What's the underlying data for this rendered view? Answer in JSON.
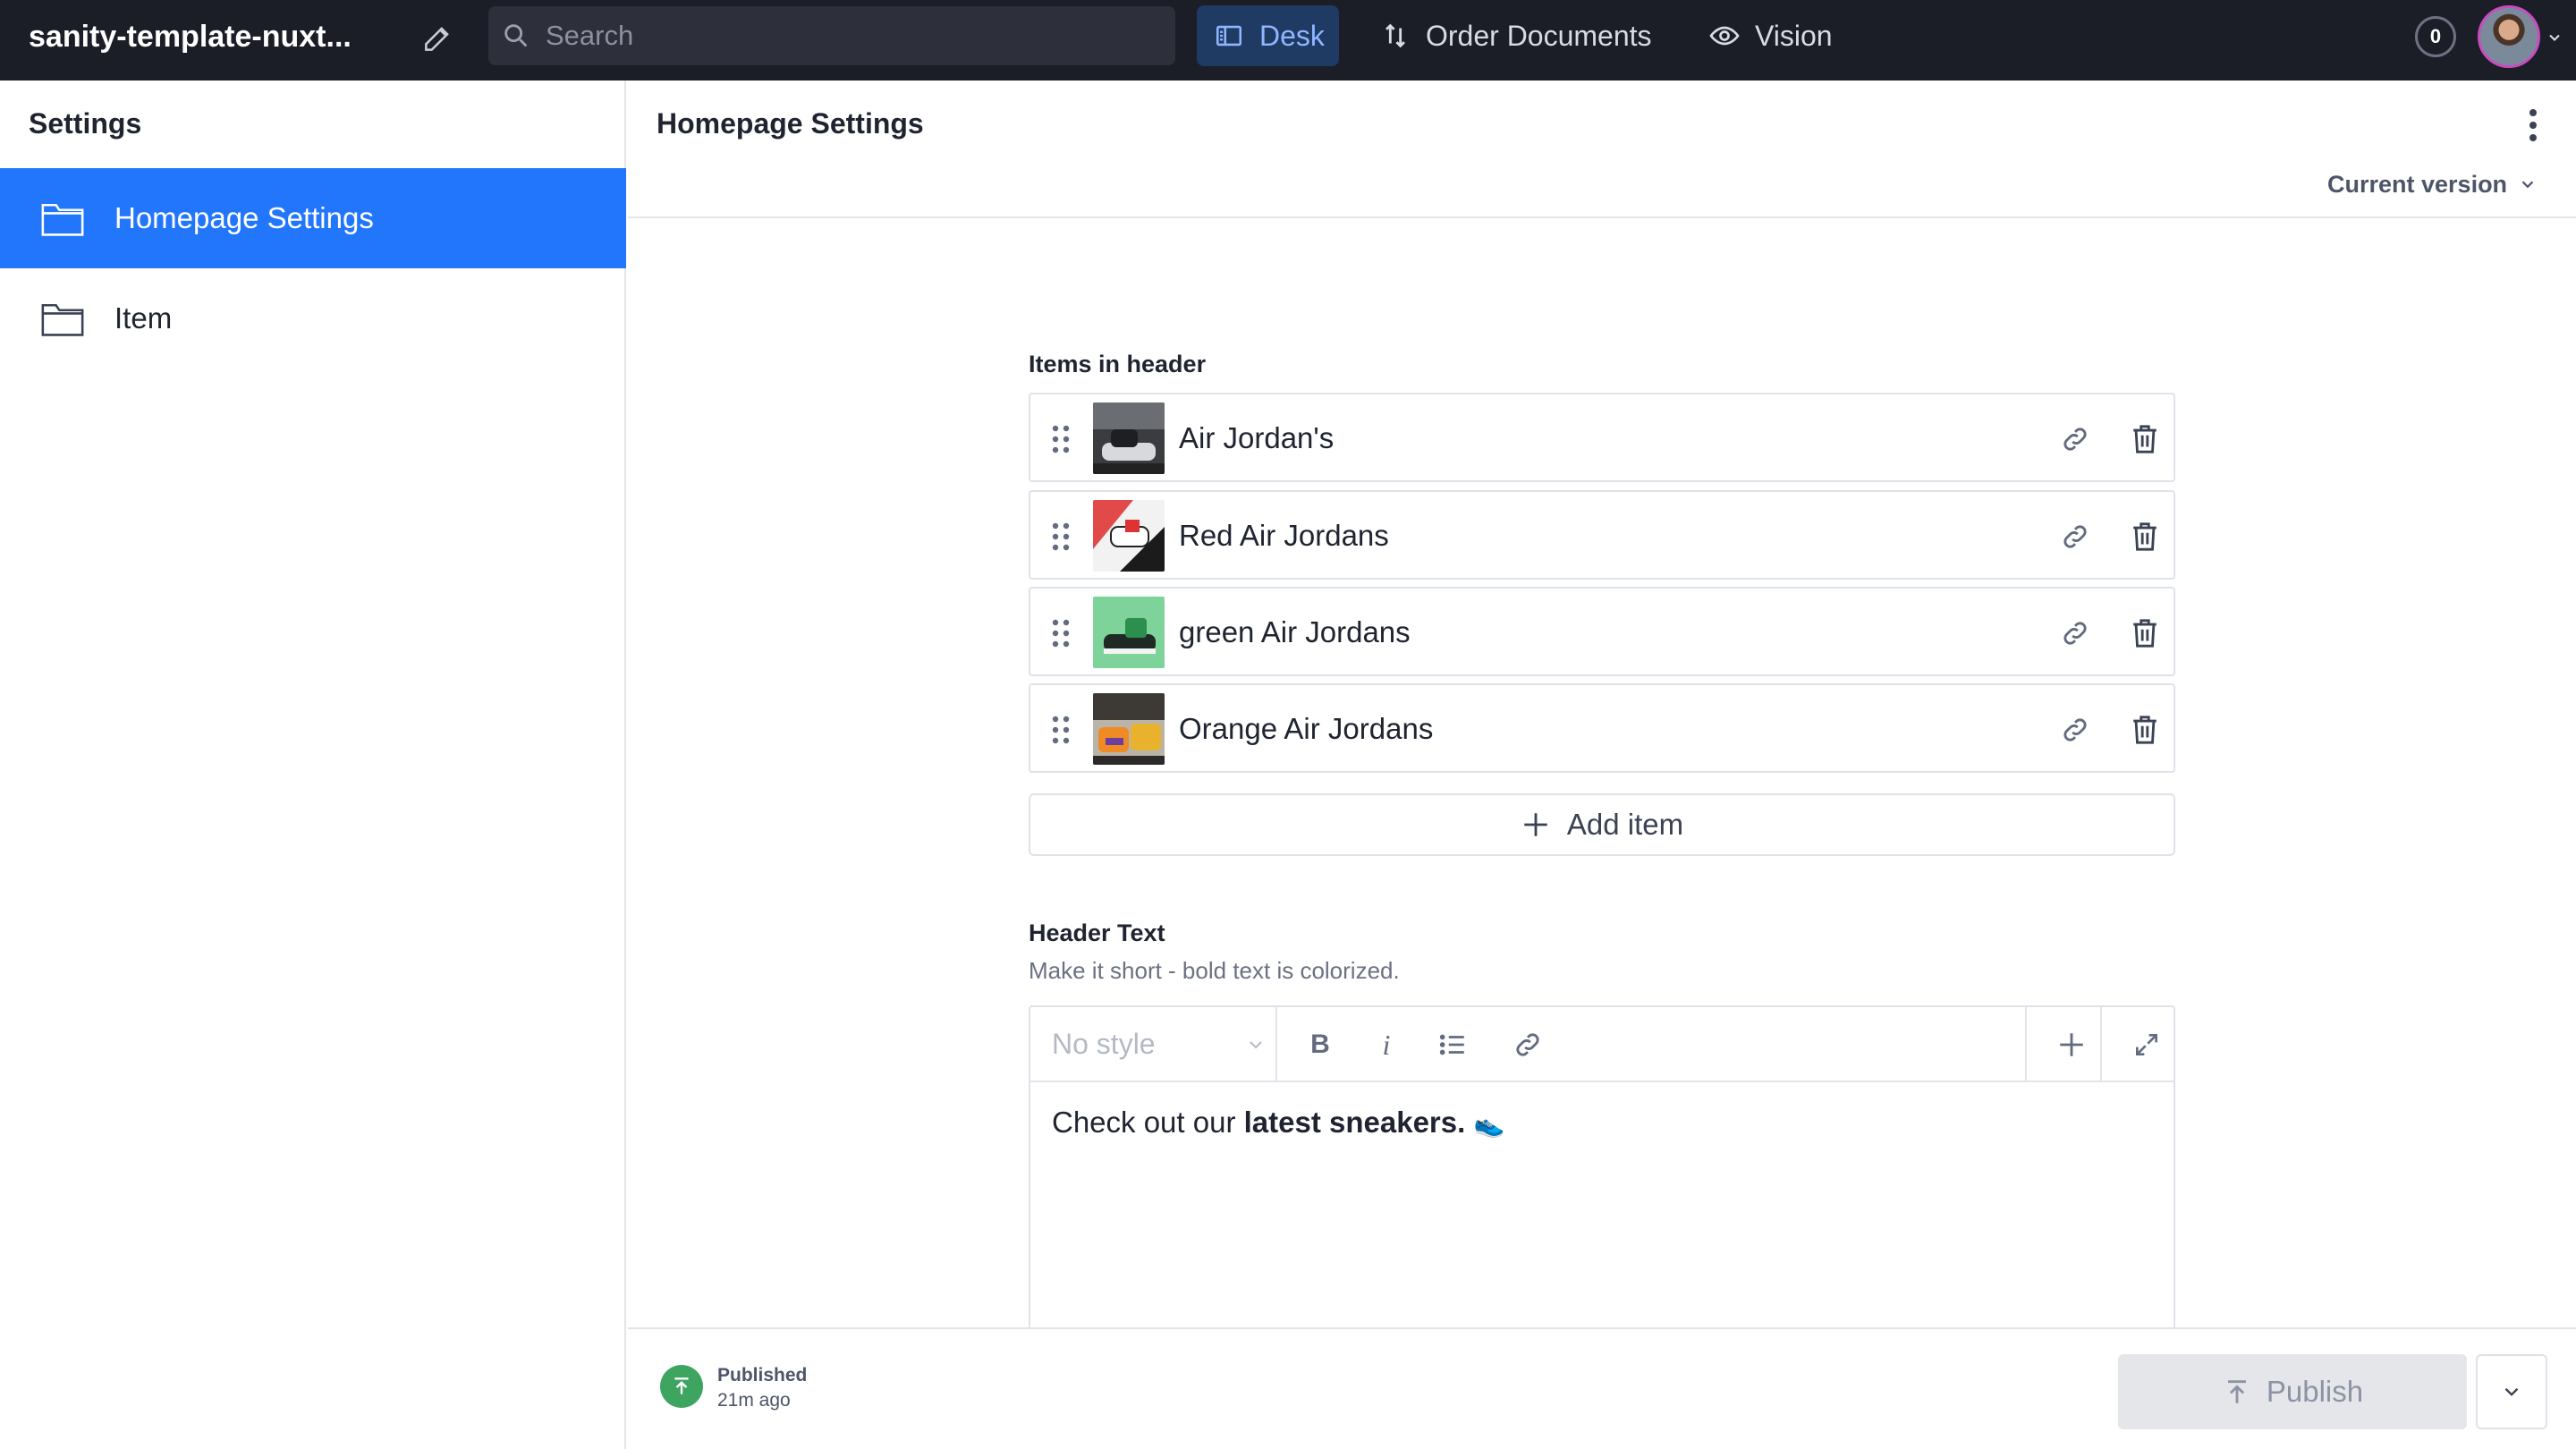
{
  "topnav": {
    "project_title": "sanity-template-nuxt...",
    "search_placeholder": "Search",
    "tools": [
      {
        "label": "Desk",
        "icon": "desk-icon",
        "active": true
      },
      {
        "label": "Order Documents",
        "icon": "sort-icon",
        "active": false
      },
      {
        "label": "Vision",
        "icon": "eye-icon",
        "active": false
      }
    ],
    "notification_count": "0",
    "accent_color": "#2276fc"
  },
  "settings_pane": {
    "title": "Settings",
    "items": [
      {
        "label": "Homepage Settings",
        "icon": "folder-icon",
        "selected": true
      },
      {
        "label": "Item",
        "icon": "folder-icon",
        "selected": false
      }
    ]
  },
  "document": {
    "title": "Homepage Settings",
    "version_label": "Current version",
    "items_field": {
      "label": "Items in header",
      "items": [
        {
          "title": "Air Jordan's",
          "thumb": "sneaker-thumbnail-dark"
        },
        {
          "title": "Red Air Jordans",
          "thumb": "sneaker-thumbnail-red"
        },
        {
          "title": "green Air Jordans",
          "thumb": "sneaker-thumbnail-green"
        },
        {
          "title": "Orange Air Jordans",
          "thumb": "sneaker-thumbnail-orange"
        }
      ],
      "add_label": "Add item"
    },
    "header_text_field": {
      "label": "Header Text",
      "description": "Make it short - bold text is colorized.",
      "style_value": "No style",
      "content_plain": "Check out our ",
      "content_bold": "latest sneakers.",
      "content_emoji": "👟"
    }
  },
  "footer": {
    "status": "Published",
    "time": "21m ago",
    "publish_label": "Publish",
    "status_color": "#3ea561"
  }
}
